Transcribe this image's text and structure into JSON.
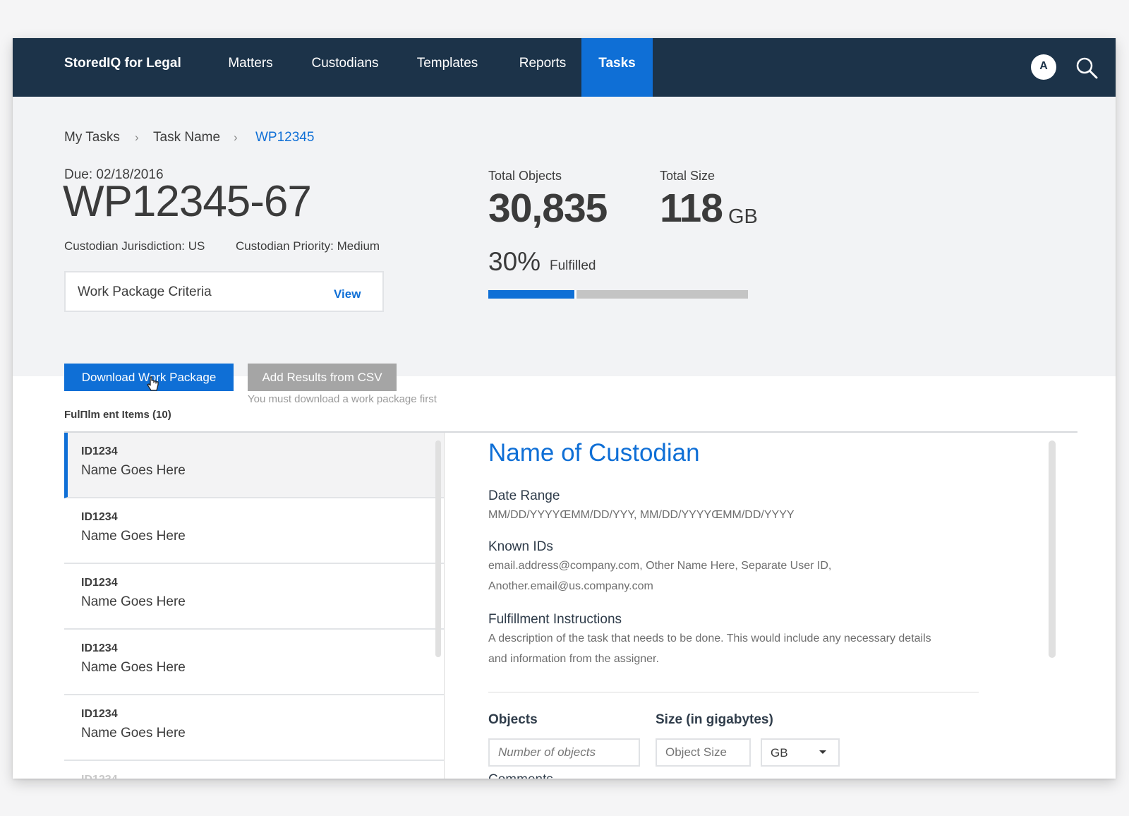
{
  "app": {
    "brand": "StoredIQ for Legal",
    "nav": [
      {
        "label": "Matters",
        "active": false
      },
      {
        "label": "Custodians",
        "active": false
      },
      {
        "label": "Templates",
        "active": false
      },
      {
        "label": "Reports",
        "active": false
      },
      {
        "label": "Tasks",
        "active": true
      }
    ],
    "avatar_initial": "A",
    "icons": {
      "search": "search-icon",
      "avatar": "avatar"
    }
  },
  "breadcrumb": [
    "My Tasks",
    "Task Name",
    "WP12345"
  ],
  "header": {
    "due": "Due: 02/18/2016",
    "title": "WP12345-67",
    "jurisdiction": "Custodian Jurisdiction: US",
    "priority": "Custodian Priority: Medium",
    "criteria_label": "Work Package Criteria",
    "criteria_link": "View"
  },
  "stats": {
    "objects_label": "Total Objects",
    "objects_value": "30,835",
    "size_label": "Total Size",
    "size_value": "118",
    "size_unit": "GB",
    "fulfilled_pct": "30%",
    "fulfilled_label": "Fulfilled",
    "fulfilled_fraction": 0.34
  },
  "actions": {
    "download_label": "Download Work Package",
    "add_csv_label": "Add Results from CSV",
    "add_csv_hint": "You must download a work package first"
  },
  "items_heading": "FulΠlm ent Items (10)",
  "items": [
    {
      "id": "ID1234",
      "name": "Name Goes Here",
      "selected": true
    },
    {
      "id": "ID1234",
      "name": "Name Goes Here",
      "selected": false
    },
    {
      "id": "ID1234",
      "name": "Name Goes Here",
      "selected": false
    },
    {
      "id": "ID1234",
      "name": "Name Goes Here",
      "selected": false
    },
    {
      "id": "ID1234",
      "name": "Name Goes Here",
      "selected": false
    },
    {
      "id": "ID1234",
      "name": "",
      "selected": false
    }
  ],
  "detail": {
    "title": "Name of Custodian",
    "date_range_label": "Date Range",
    "date_range_value": "MM/DD/YYYYŒMM/DD/YYY, MM/DD/YYYYŒMM/DD/YYYY",
    "known_ids_label": "Known IDs",
    "known_ids_line1": "email.address@company.com, Other Name Here, Separate User ID,",
    "known_ids_line2": "Another.email@us.company.com",
    "instructions_label": "Fulfillment Instructions",
    "instructions_line1": "A description of the task that needs to be done. This would include any necessary details",
    "instructions_line2": "and information from the assigner.",
    "objects_label": "Objects",
    "objects_placeholder": "Number of objects",
    "size_label": "Size (in gigabytes)",
    "size_placeholder": "Object Size",
    "size_unit_selected": "GB",
    "next_label_partial": "Comments"
  },
  "colors": {
    "nav_bg": "#1c3349",
    "accent": "#0f6fd6",
    "disabled": "#a5a5a5"
  }
}
